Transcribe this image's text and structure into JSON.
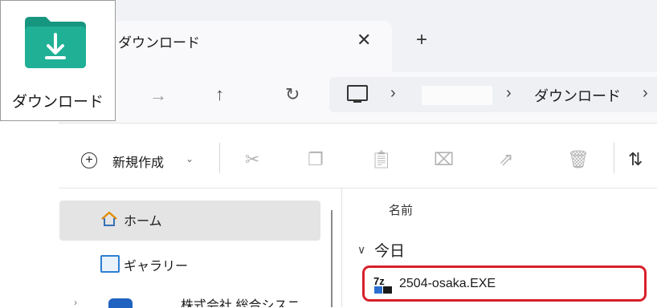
{
  "window": {
    "tab_title": "ダウンロード",
    "tab_close_icon": "close-icon",
    "new_tab_icon": "plus-icon"
  },
  "nav": {
    "forward_icon": "arrow-right-icon",
    "up_icon": "arrow-up-icon",
    "refresh_icon": "refresh-icon",
    "address": {
      "root_icon": "computer-icon",
      "crumbs": [
        "",
        "ダウンロード"
      ]
    }
  },
  "toolbar": {
    "new_label": "新規作成",
    "icons": [
      "cut-icon",
      "copy-icon",
      "paste-icon",
      "rename-icon",
      "share-icon",
      "delete-icon",
      "sort-icon"
    ]
  },
  "sidebar": {
    "items": [
      {
        "label": "ホーム",
        "icon": "home-icon",
        "selected": true
      },
      {
        "label": "ギャラリー",
        "icon": "gallery-icon"
      },
      {
        "label": "株式会社 総合シスニ",
        "icon": "cloud-icon"
      }
    ]
  },
  "content": {
    "column_name": "名前",
    "group_label": "今日",
    "files": [
      {
        "name": "2504-osaka.EXE",
        "icon": "7z-archive-icon",
        "highlighted": true
      }
    ]
  },
  "overlay": {
    "label": "ダウンロード",
    "icon": "download-folder-icon",
    "color": "#1aa68f"
  },
  "colors": {
    "highlight_border": "#d8202a",
    "selection_bg": "#e4e4e4"
  }
}
